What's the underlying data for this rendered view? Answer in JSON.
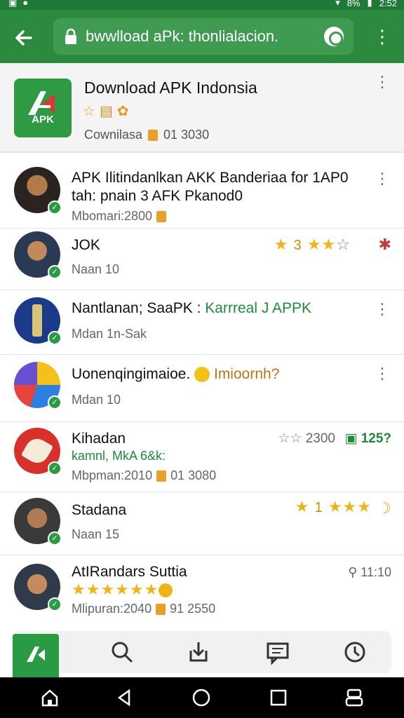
{
  "status_bar": {
    "time": "2:52",
    "battery": "8%"
  },
  "toolbar": {
    "url": "bwwlload aPk: thonlialacion."
  },
  "header": {
    "app_title": "Download APK Indonsia",
    "logo_text": "APK",
    "meta_label": "Cownilasa",
    "meta_count": "01 3030"
  },
  "items": [
    {
      "title": "APK Ilitindanlkan AKK Banderiaa  for 1AP0",
      "title2": "tah: pnain 3 AFK Pkanod0",
      "sub": "Mbomari:2800"
    },
    {
      "title": "JOK",
      "sub": "Naan  10",
      "rating": "3"
    },
    {
      "title": "Nantlanan; SaaPK : ",
      "title_accent": "Karrreal J APPK",
      "sub": "Mdan  1n-Sak"
    },
    {
      "title": "Uonenqingimaioe.",
      "title_accent": "Imioornh?",
      "sub": "Mdan  10"
    },
    {
      "title": "Kihadan",
      "title2": "kamnl, MkA 6&k:",
      "sub": "Mbpman:2010",
      "sub_count": "01 3080",
      "rating_text": "2300",
      "badge_text": "125?"
    },
    {
      "title": "Stadana",
      "sub": "Naan  15",
      "rating": "1"
    },
    {
      "title": "AtIRandars Suttia",
      "sub": "Mlipuran:2040",
      "sub_count": "91 2550",
      "time": "11:10"
    }
  ],
  "colors": {
    "brand": "#2b8a3e",
    "star": "#f0b41a",
    "check": "#2b9a45"
  }
}
